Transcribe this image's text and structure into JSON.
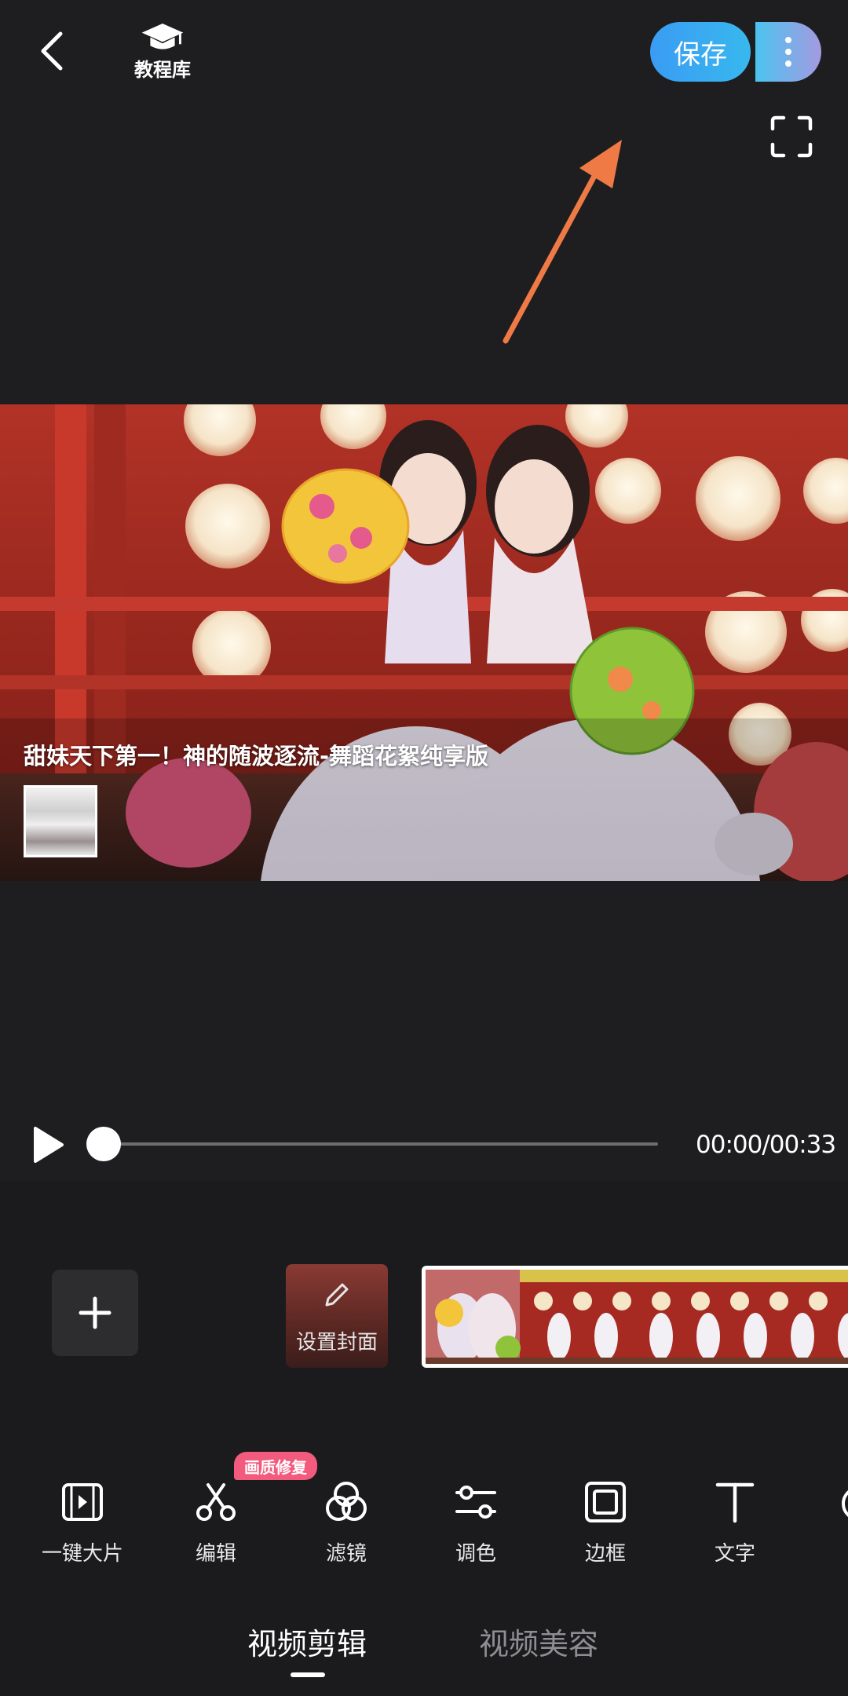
{
  "header": {
    "tutorial_label": "教程库",
    "save_label": "保存"
  },
  "preview": {
    "video_title": "甜妹天下第一！神的随波逐流-舞蹈花絮纯享版"
  },
  "playback": {
    "time": "00:00/00:33",
    "progress": 0.0
  },
  "timeline": {
    "cover_label": "设置封面"
  },
  "toolbar": {
    "badge": "画质修复",
    "items": [
      {
        "label": "一键大片",
        "icon": "film-icon"
      },
      {
        "label": "编辑",
        "icon": "scissors-icon"
      },
      {
        "label": "滤镜",
        "icon": "filter-icon"
      },
      {
        "label": "调色",
        "icon": "adjust-icon"
      },
      {
        "label": "边框",
        "icon": "frame-icon"
      },
      {
        "label": "文字",
        "icon": "text-icon"
      }
    ]
  },
  "tabs": {
    "active": "视频剪辑",
    "inactive": "视频美容"
  },
  "colors": {
    "background": "#1e1e20",
    "save_gradient_start": "#3a9cf3",
    "more_gradient_end": "#a49ae0",
    "badge": "#f25b7d",
    "annotation_arrow": "#f07a45"
  }
}
